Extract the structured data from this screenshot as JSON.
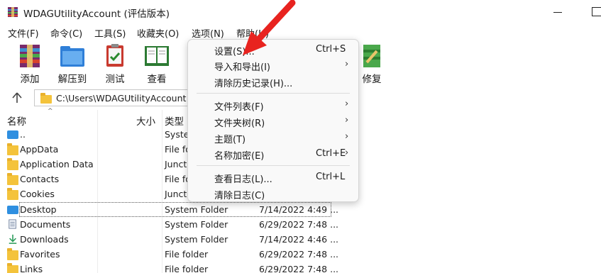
{
  "window": {
    "title": "WDAGUtilityAccount (评估版本)"
  },
  "menubar": [
    "文件(F)",
    "命令(C)",
    "工具(S)",
    "收藏夹(O)",
    "选项(N)",
    "帮助(H)"
  ],
  "toolbar": {
    "add": "添加",
    "extract": "解压到",
    "test": "测试",
    "view": "查看",
    "repair": "修复"
  },
  "address": {
    "path": "C:\\Users\\WDAGUtilityAccount"
  },
  "columns": {
    "name": "名称",
    "size": "大小",
    "type": "类型"
  },
  "files": [
    {
      "name": "..",
      "type": "System Folder",
      "date": ""
    },
    {
      "name": "AppData",
      "type": "File folder",
      "date": ""
    },
    {
      "name": "Application Data",
      "type": "Junction",
      "date": ""
    },
    {
      "name": "Contacts",
      "type": "File folder",
      "date": ""
    },
    {
      "name": "Cookies",
      "type": "Junction",
      "date": ""
    },
    {
      "name": "Desktop",
      "type": "System Folder",
      "date": "7/14/2022 4:49 ..."
    },
    {
      "name": "Documents",
      "type": "System Folder",
      "date": "6/29/2022 7:48 ..."
    },
    {
      "name": "Downloads",
      "type": "System Folder",
      "date": "7/14/2022 4:46 ..."
    },
    {
      "name": "Favorites",
      "type": "File folder",
      "date": "6/29/2022 7:48 ..."
    },
    {
      "name": "Links",
      "type": "File folder",
      "date": "6/29/2022 7:48 ..."
    }
  ],
  "options_menu": {
    "settings": {
      "label": "设置(S)...",
      "shortcut": "Ctrl+S"
    },
    "import_export": {
      "label": "导入和导出(I)"
    },
    "clear_history": {
      "label": "清除历史记录(H)..."
    },
    "file_list": {
      "label": "文件列表(F)"
    },
    "folder_tree": {
      "label": "文件夹树(R)"
    },
    "themes": {
      "label": "主题(T)"
    },
    "name_encryption": {
      "label": "名称加密(E)",
      "shortcut": "Ctrl+E"
    },
    "view_log": {
      "label": "查看日志(L)...",
      "shortcut": "Ctrl+L"
    },
    "clear_log": {
      "label": "清除日志(C)"
    },
    "submenu_arrow": "›"
  },
  "colors": {
    "folder": "#f4c33b",
    "annotation_arrow": "#e8231f",
    "menu_bg": "#f9f9f9"
  }
}
